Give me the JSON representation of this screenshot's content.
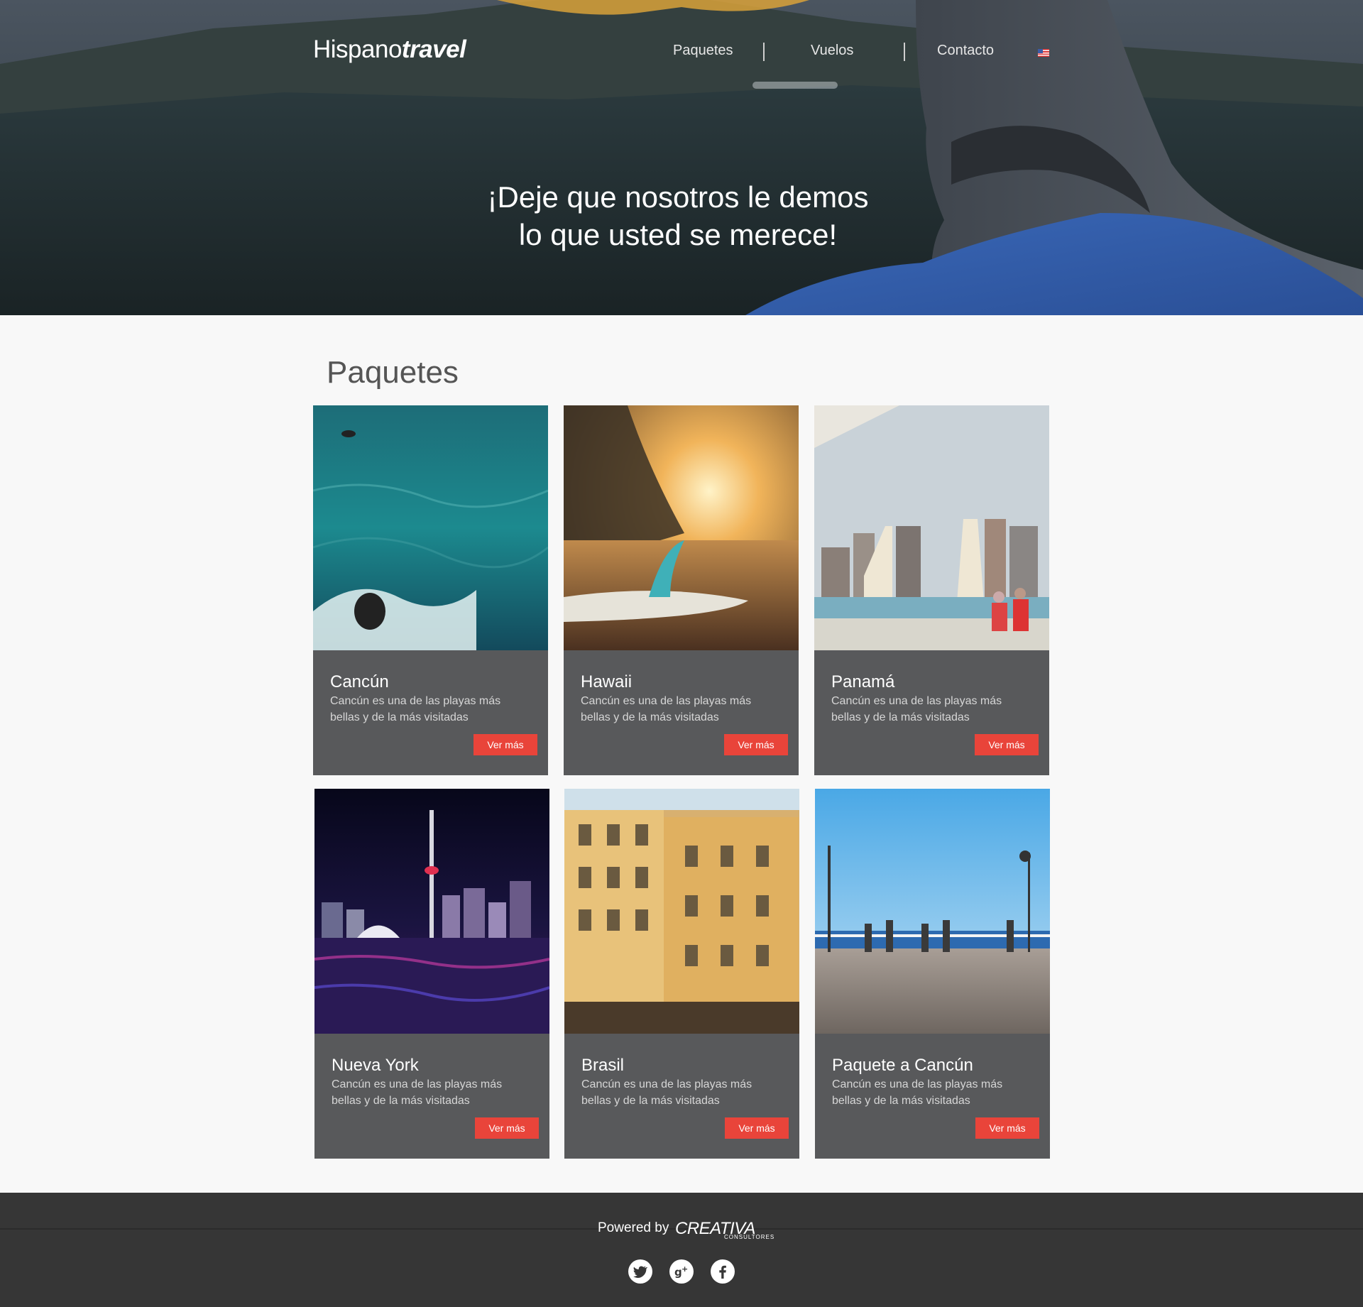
{
  "brand": {
    "name_light": "Hispano",
    "name_bold": "travel"
  },
  "nav": {
    "items": [
      "Paquetes",
      "Vuelos",
      "Contacto"
    ],
    "language_flag": "us-flag-icon"
  },
  "hero": {
    "line1": "¡Deje que nosotros le demos",
    "line2": "lo que usted se merece!"
  },
  "packages": {
    "title": "Paquetes",
    "items": [
      {
        "name": "Cancún",
        "description": "Cancún es una de las playas más bellas y de la más visitadas",
        "button": "Ver más"
      },
      {
        "name": "Hawaii",
        "description": "Cancún es una de las playas más bellas y de la más visitadas",
        "button": "Ver más"
      },
      {
        "name": "Panamá",
        "description": "Cancún es una de las playas más bellas y de la más visitadas",
        "button": "Ver más"
      },
      {
        "name": "Nueva York",
        "description": "Cancún es una de las playas más bellas y de la más visitadas",
        "button": "Ver más"
      },
      {
        "name": "Brasil",
        "description": "Cancún es una de las playas más bellas y de la más visitadas",
        "button": "Ver más"
      },
      {
        "name": "Paquete a Cancún",
        "description": "Cancún es una de las playas más bellas y de la más visitadas",
        "button": "Ver más"
      }
    ]
  },
  "footer": {
    "powered_by": "Powered by",
    "company": "CREATIVA",
    "company_sub": "CONSULTORES",
    "social": [
      "twitter-icon",
      "google-plus-icon",
      "facebook-icon"
    ]
  },
  "colors": {
    "accent": "#e9443a",
    "card": "#58595b",
    "footer": "#363636",
    "background": "#f8f8f8"
  }
}
